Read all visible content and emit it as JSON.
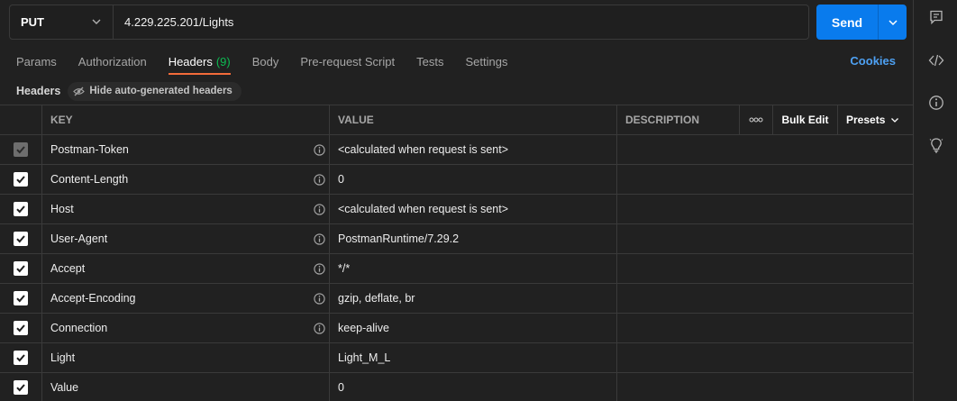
{
  "request": {
    "method": "PUT",
    "url": "4.229.225.201/Lights",
    "send_label": "Send"
  },
  "tabs": [
    {
      "label": "Params"
    },
    {
      "label": "Authorization"
    },
    {
      "label": "Headers",
      "count": "(9)"
    },
    {
      "label": "Body"
    },
    {
      "label": "Pre-request Script"
    },
    {
      "label": "Tests"
    },
    {
      "label": "Settings"
    }
  ],
  "active_tab": "Headers",
  "cookies_label": "Cookies",
  "headers_section": {
    "label": "Headers",
    "hide_button": "Hide auto-generated headers"
  },
  "table": {
    "columns": {
      "key": "KEY",
      "value": "VALUE",
      "description": "DESCRIPTION",
      "more": "ooo",
      "bulk_edit": "Bulk Edit",
      "presets": "Presets"
    },
    "rows": [
      {
        "key": "Postman-Token",
        "value": "<calculated when request is sent>",
        "checked": true,
        "disabled": true,
        "info": true
      },
      {
        "key": "Content-Length",
        "value": "0",
        "checked": true,
        "disabled": false,
        "info": true
      },
      {
        "key": "Host",
        "value": "<calculated when request is sent>",
        "checked": true,
        "disabled": false,
        "info": true
      },
      {
        "key": "User-Agent",
        "value": "PostmanRuntime/7.29.2",
        "checked": true,
        "disabled": false,
        "info": true
      },
      {
        "key": "Accept",
        "value": "*/*",
        "checked": true,
        "disabled": false,
        "info": true
      },
      {
        "key": "Accept-Encoding",
        "value": "gzip, deflate, br",
        "checked": true,
        "disabled": false,
        "info": true
      },
      {
        "key": "Connection",
        "value": "keep-alive",
        "checked": true,
        "disabled": false,
        "info": true
      },
      {
        "key": "Light",
        "value": "Light_M_L",
        "checked": true,
        "disabled": false,
        "info": false
      },
      {
        "key": "Value",
        "value": "0",
        "checked": true,
        "disabled": false,
        "info": false
      }
    ]
  },
  "sidebar": {
    "icons": [
      "comment-icon",
      "code-icon",
      "info-icon",
      "lightbulb-icon"
    ]
  },
  "colors": {
    "background": "#212121",
    "send_button": "#097bed",
    "active_tab_underline": "#f26b3a",
    "count_green": "#0cbb52",
    "link_blue": "#4ea1f3"
  }
}
